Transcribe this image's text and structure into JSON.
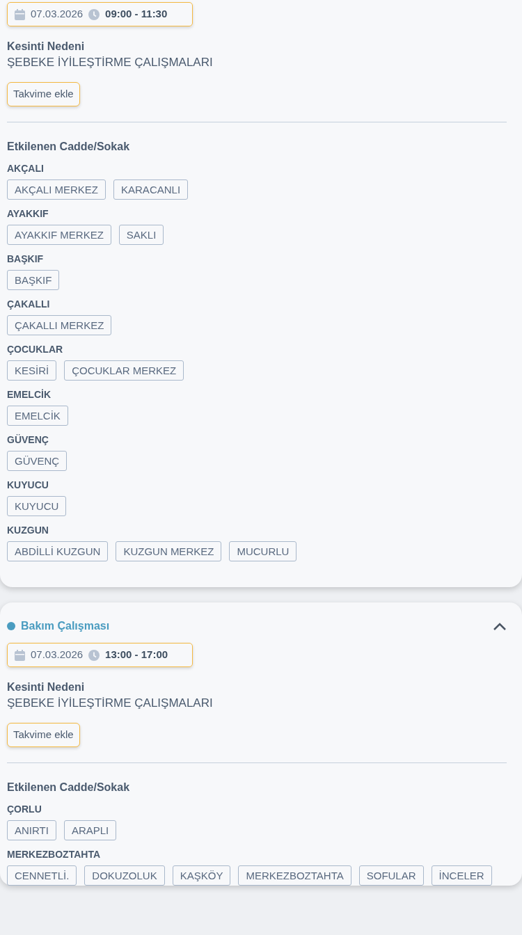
{
  "outages": [
    {
      "date": "07.03.2026",
      "time": "09:00 - 11:30",
      "reason_label": "Kesinti Nedeni",
      "reason": "ŞEBEKE İYİLEŞTİRME ÇALIŞMALARI",
      "calendar_button": "Takvime ekle",
      "streets_label": "Etkilenen Cadde/Sokak",
      "groups": [
        {
          "name": "AKÇALI",
          "streets": [
            "AKÇALI MERKEZ",
            "KARACANLI"
          ]
        },
        {
          "name": "AYAKKIF",
          "streets": [
            "AYAKKIF MERKEZ",
            "SAKLI"
          ]
        },
        {
          "name": "BAŞKIF",
          "streets": [
            "BAŞKIF"
          ]
        },
        {
          "name": "ÇAKALLI",
          "streets": [
            "ÇAKALLI MERKEZ"
          ]
        },
        {
          "name": "ÇOCUKLAR",
          "streets": [
            "KESİRİ",
            "ÇOCUKLAR MERKEZ"
          ]
        },
        {
          "name": "EMELCİK",
          "streets": [
            "EMELCİK"
          ]
        },
        {
          "name": "GÜVENÇ",
          "streets": [
            "GÜVENÇ"
          ]
        },
        {
          "name": "KUYUCU",
          "streets": [
            "KUYUCU"
          ]
        },
        {
          "name": "KUZGUN",
          "streets": [
            "ABDİLLİ KUZGUN",
            "KUZGUN MERKEZ",
            "MUCURLU"
          ]
        }
      ]
    },
    {
      "title": "Bakım Çalışması",
      "color": "#4a9cc0",
      "expanded": true,
      "date": "07.03.2026",
      "time": "13:00 - 17:00",
      "reason_label": "Kesinti Nedeni",
      "reason": "ŞEBEKE İYİLEŞTİRME ÇALIŞMALARI",
      "calendar_button": "Takvime ekle",
      "streets_label": "Etkilenen Cadde/Sokak",
      "groups": [
        {
          "name": "ÇORLU",
          "streets": [
            "ANIRTI",
            "ARAPLI"
          ]
        },
        {
          "name": "MERKEZBOZTAHTA",
          "streets": [
            "CENNETLİ.",
            "DOKUZOLUK",
            "KAŞKÖY",
            "MERKEZBOZTAHTA",
            "SOFULAR",
            "İNCELER"
          ]
        }
      ]
    }
  ]
}
